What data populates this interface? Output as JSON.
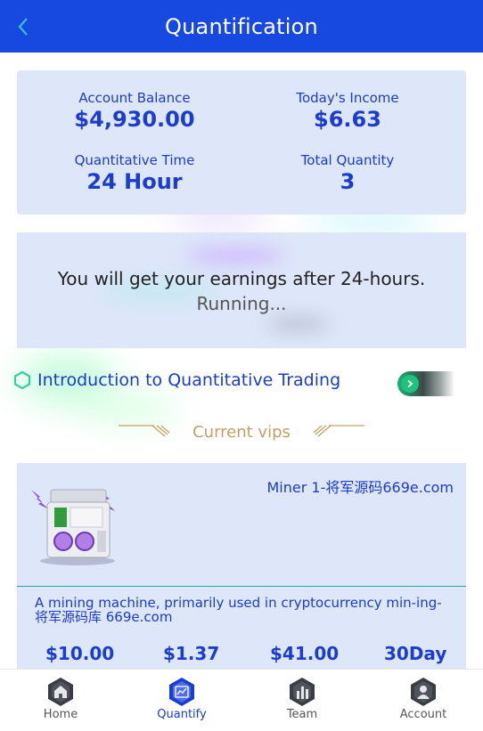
{
  "header": {
    "title": "Quantification"
  },
  "stats": {
    "account_balance_label": "Account Balance",
    "account_balance_value": "$4,930.00",
    "todays_income_label": "Today's Income",
    "todays_income_value": "$6.63",
    "quant_time_label": "Quantitative Time",
    "quant_time_value": "24 Hour",
    "total_quantity_label": "Total Quantity",
    "total_quantity_value": "3"
  },
  "status": {
    "message": "You will get your earnings after 24-hours.",
    "running": "Running..."
  },
  "intro": {
    "label": "Introduction to Quantitative Trading"
  },
  "section": {
    "title": "Current vips"
  },
  "vip": {
    "name": "Miner 1-将军源码669e.com",
    "description": "A mining machine, primarily used in cryptocurrency min-ing-将军源码库 669e.com",
    "price": "$10.00",
    "daily": "$1.37",
    "total": "$41.00",
    "duration": "30Day"
  },
  "nav": {
    "items": [
      {
        "label": "Home",
        "icon": "home-icon"
      },
      {
        "label": "Quantify",
        "icon": "quantify-icon"
      },
      {
        "label": "Team",
        "icon": "team-icon"
      },
      {
        "label": "Account",
        "icon": "account-icon"
      }
    ],
    "active": "Quantify"
  },
  "colors": {
    "primary": "#1749e0",
    "card_bg": "#dee6fa",
    "text_blue": "#1c3cc8",
    "gold": "#c2a266",
    "green": "#1fc37e",
    "teal_divider": "#26a69a"
  }
}
